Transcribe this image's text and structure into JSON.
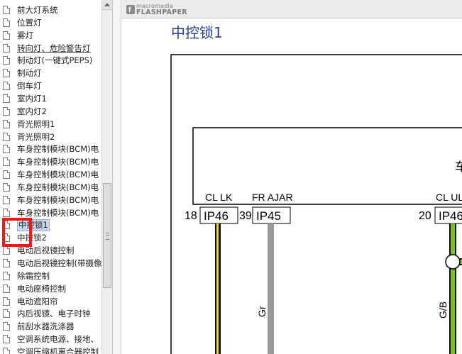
{
  "tree": {
    "items": [
      {
        "label": "前大灯系统"
      },
      {
        "label": "位置灯"
      },
      {
        "label": "雾灯"
      },
      {
        "label": "转向灯、危险警告灯",
        "underlined": true
      },
      {
        "label": "制动灯(一键式PEPS)"
      },
      {
        "label": "制动灯"
      },
      {
        "label": "倒车灯"
      },
      {
        "label": "室内灯1"
      },
      {
        "label": "室内灯2"
      },
      {
        "label": "背光照明1"
      },
      {
        "label": "背光照明2"
      },
      {
        "label": "车身控制模块(BCM)电"
      },
      {
        "label": "车身控制模块(BCM)电"
      },
      {
        "label": "车身控制模块(BCM)电"
      },
      {
        "label": "车身控制模块(BCM)电"
      },
      {
        "label": "车身控制模块(BCM)电"
      },
      {
        "label": "车身控制模块(BCM)电"
      },
      {
        "label": "中控锁1",
        "selected": true
      },
      {
        "label": "中控锁2"
      },
      {
        "label": "电动后视镜控制"
      },
      {
        "label": "电动后视镜控制(带摄像"
      },
      {
        "label": "除霜控制"
      },
      {
        "label": "电动座椅控制"
      },
      {
        "label": "电动遮阳帘"
      },
      {
        "label": "内后视镜、电子时钟"
      },
      {
        "label": "前刮水器洗涤器"
      },
      {
        "label": "空调系统电源、接地、"
      },
      {
        "label": "空调压缩机离合器控制"
      }
    ]
  },
  "viewer": {
    "logo_top": "macromedia",
    "logo_bottom": "FLASHPAPER",
    "page_title": "中控锁1"
  },
  "diagram": {
    "module_label_partial": "车",
    "pins": [
      {
        "signal": "CL LK",
        "number": "18",
        "connector": "IP46",
        "wire": ""
      },
      {
        "signal": "FR AJAR",
        "number": "39",
        "connector": "IP45",
        "wire": "Gr"
      },
      {
        "signal": "CL UL",
        "number": "20",
        "connector": "IP46",
        "wire": "G/B"
      }
    ]
  },
  "colors": {
    "title": "#2b3d8f",
    "highlight": "#ff1414",
    "wire_yellow": "#ffd400",
    "wire_gray": "#9a9a9a",
    "wire_green": "#7cc21f"
  }
}
